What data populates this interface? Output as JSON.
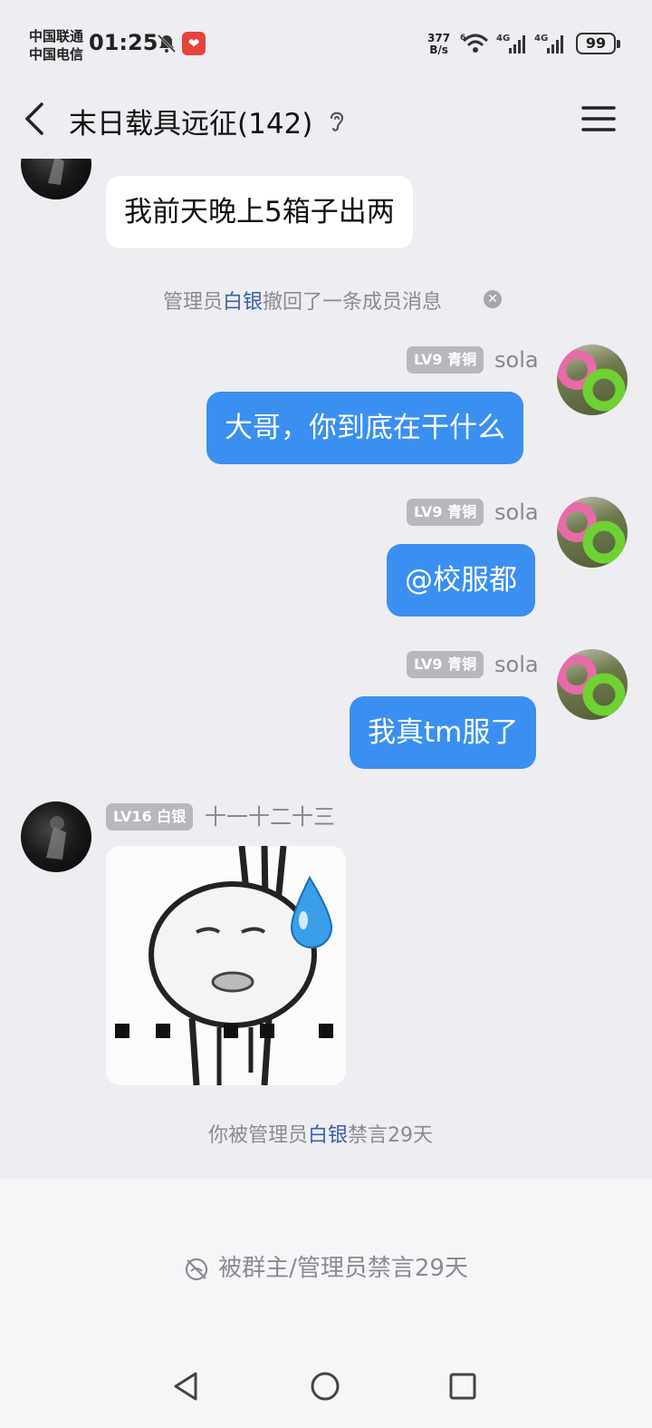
{
  "status_bar": {
    "carrier_1": "中国联通",
    "carrier_2": "中国电信",
    "time": "01:25",
    "net_speed_value": "377",
    "net_speed_unit": "B/s",
    "wifi_label": "6",
    "signal_1_label": "4G",
    "signal_2_label": "4G",
    "battery": "99"
  },
  "header": {
    "title": "末日载具远征(142)"
  },
  "messages": [
    {
      "type": "text",
      "side": "left",
      "text": "我前天晚上5箱子出两"
    },
    {
      "type": "system",
      "prefix": "管理员",
      "highlight": "白银",
      "suffix": "撤回了一条成员消息"
    },
    {
      "type": "text",
      "side": "right",
      "badge": "LV9 青铜",
      "sender": "sola",
      "text": "大哥，你到底在干什么"
    },
    {
      "type": "text",
      "side": "right",
      "badge": "LV9 青铜",
      "sender": "sola",
      "text": "@校服都"
    },
    {
      "type": "text",
      "side": "right",
      "badge": "LV9 青铜",
      "sender": "sola",
      "text": "我真tm服了"
    },
    {
      "type": "sticker",
      "side": "left",
      "badge": "LV16 白银",
      "sender": "十一十二十三"
    },
    {
      "type": "system",
      "prefix": "你被管理员",
      "highlight": "白银",
      "suffix": "禁言29天"
    }
  ],
  "bottom": {
    "mute_notice": "被群主/管理员禁言29天"
  },
  "colors": {
    "background": "#ededf2",
    "bubble_self": "#3a8ff0",
    "bubble_other": "#ffffff",
    "highlight_name": "#3b5fa6"
  }
}
